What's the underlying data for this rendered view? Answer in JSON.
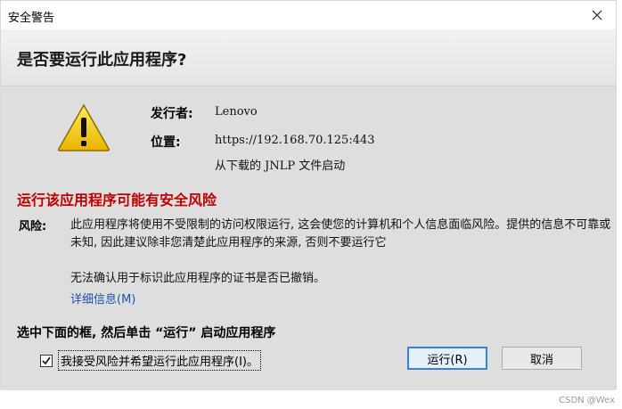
{
  "window": {
    "title": "安全警告",
    "close_icon": "close-icon"
  },
  "header": {
    "headline": "是否要运行此应用程序?"
  },
  "info": {
    "publisher_label": "发行者:",
    "publisher_value": "Lenovo",
    "location_label": "位置:",
    "location_value": "https://192.168.70.125:443",
    "source_value": "从下载的 JNLP 文件启动"
  },
  "risk": {
    "title": "运行该应用程序可能有安全风险",
    "label": "风险:",
    "text": "此应用程序将使用不受限制的访问权限运行, 这会使您的计算机和个人信息面临风险。提供的信息不可靠或未知, 因此建议除非您清楚此应用程序的来源, 否则不要运行它",
    "cert_notice": "无法确认用于标识此应用程序的证书是否已撤销。",
    "details_link": "详细信息(M)"
  },
  "instruction": "选中下面的框, 然后单击 “运行” 启动应用程序",
  "accept": {
    "checked": true,
    "label": "我接受风险并希望运行此应用程序(I)。"
  },
  "buttons": {
    "run": "运行(R)",
    "cancel": "取消"
  },
  "watermark": "CSDN @Wex",
  "colors": {
    "risk_red": "#c00000",
    "link_blue": "#2050b0",
    "content_bg": "#dedede",
    "warning_yellow": "#f7d21e"
  }
}
